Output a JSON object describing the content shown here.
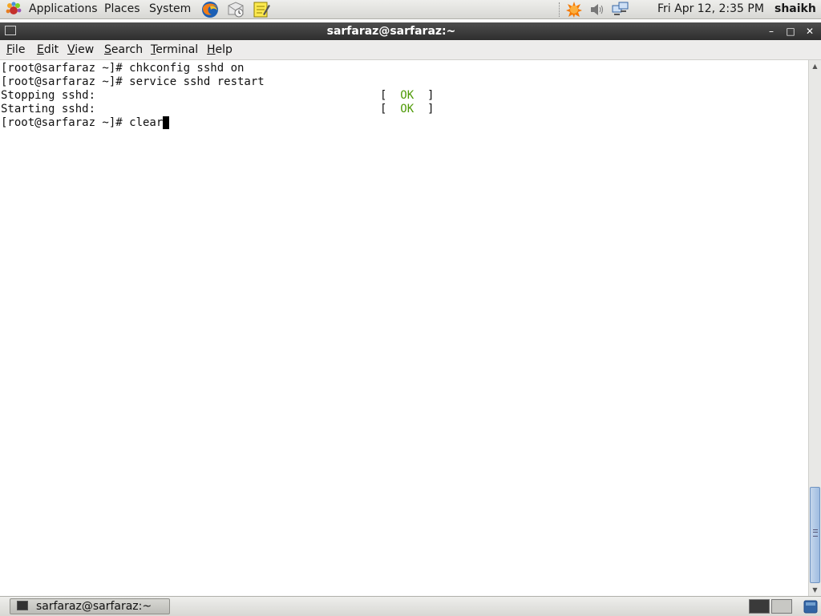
{
  "top_panel": {
    "menus": [
      "Applications",
      "Places",
      "System"
    ],
    "clock": "Fri Apr 12,  2:35 PM",
    "user": "shaikh"
  },
  "window": {
    "title": "sarfaraz@sarfaraz:~",
    "controls": {
      "minimize": "–",
      "maximize": "□",
      "close": "✕"
    }
  },
  "menubar": {
    "items": [
      {
        "u": "F",
        "rest": "ile"
      },
      {
        "u": "E",
        "rest": "dit"
      },
      {
        "u": "V",
        "rest": "iew"
      },
      {
        "u": "S",
        "rest": "earch"
      },
      {
        "u": "T",
        "rest": "erminal"
      },
      {
        "u": "H",
        "rest": "elp"
      }
    ]
  },
  "terminal": {
    "lines": [
      "[root@sarfaraz ~]# chkconfig sshd on",
      "[root@sarfaraz ~]# service sshd restart",
      "Stopping sshd:",
      "Starting sshd:",
      "[root@sarfaraz ~]# clear"
    ],
    "status": {
      "open": "[  ",
      "word": "OK",
      "close": "  ]"
    }
  },
  "taskbar": {
    "task_label": "sarfaraz@sarfaraz:~"
  },
  "colors": {
    "ok_green": "#4e9a06",
    "titlebar": "#3a3a3a"
  }
}
